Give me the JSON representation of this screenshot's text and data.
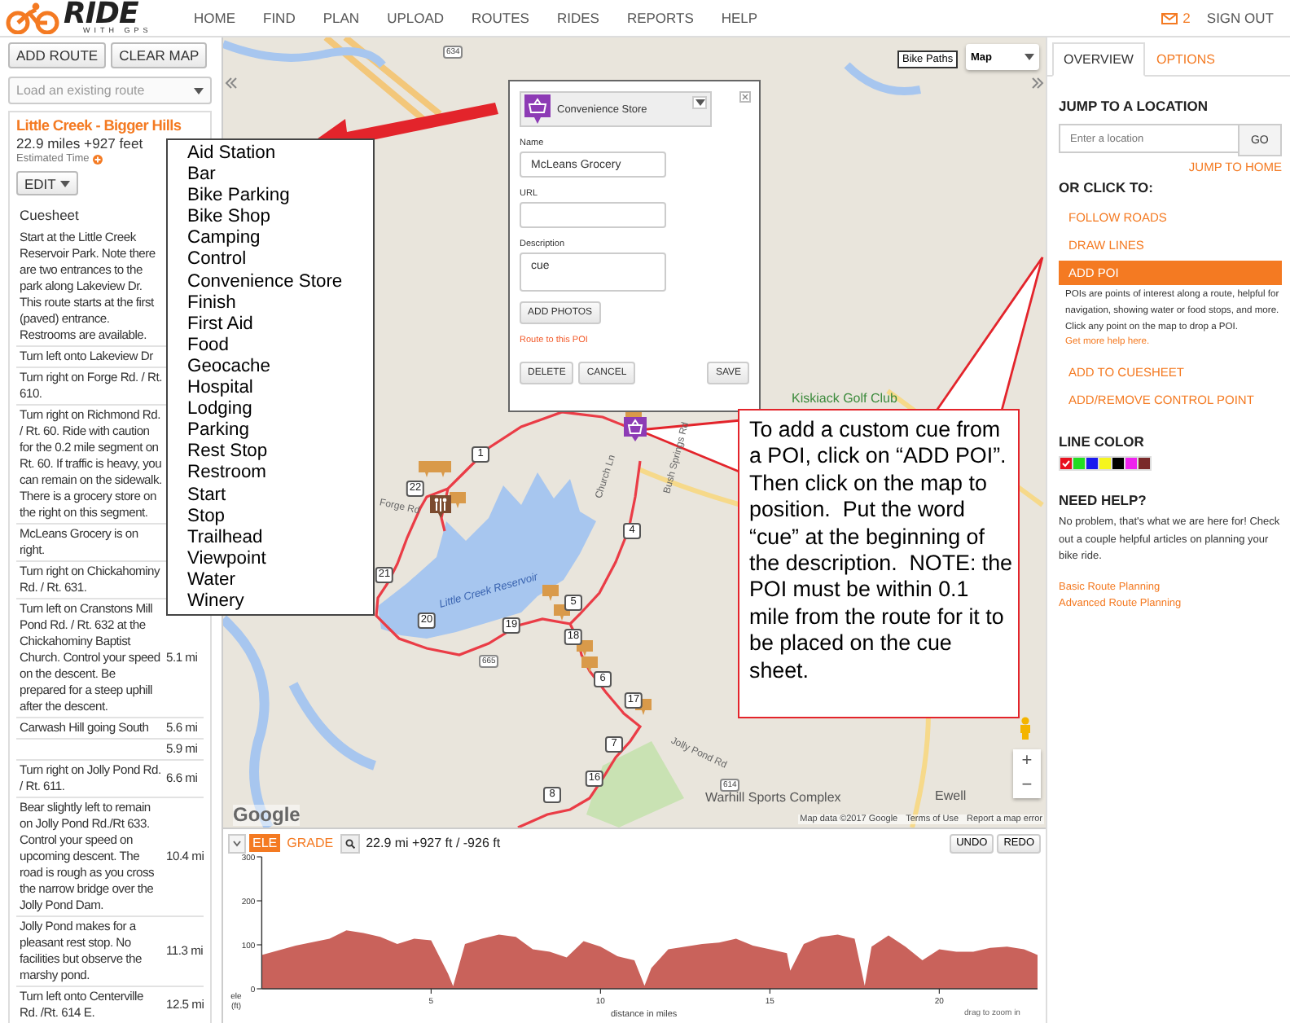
{
  "header": {
    "logo": {
      "wordmark": "RIDE",
      "tagline": "WITH GPS"
    },
    "nav": [
      {
        "label": "HOME"
      },
      {
        "label": "FIND"
      },
      {
        "label": "PLAN"
      },
      {
        "label": "UPLOAD"
      },
      {
        "label": "ROUTES"
      },
      {
        "label": "RIDES"
      },
      {
        "label": "REPORTS"
      },
      {
        "label": "HELP"
      }
    ],
    "message_count": "2",
    "sign_out": "SIGN OUT"
  },
  "left_panel": {
    "buttons": [
      "ADD ROUTE",
      "CLEAR MAP"
    ],
    "route_select": {
      "placeholder": "Load an existing route"
    },
    "route": {
      "title": "Little Creek - Bigger Hills",
      "stats": "22.9 miles +927 feet",
      "estimated_time": "Estimated Time",
      "edit_button": "EDIT"
    },
    "cuesheet": {
      "title": "Cuesheet",
      "rows": [
        {
          "text": "Start at the Little Creek Reservoir Park. Note there are two entrances to the park along Lakeview Dr. This route starts at the first (paved) entrance. Restrooms are available."
        },
        {
          "text": "Turn left onto Lakeview Dr"
        },
        {
          "text": "Turn right on Forge Rd. / Rt. 610."
        },
        {
          "text": "Turn right on Richmond Rd. / Rt. 60. Ride with caution for the 0.2 mile segment on Rt. 60. If traffic is heavy, you can remain on the sidewalk. There is a grocery store on the right on this segment."
        },
        {
          "text": "McLeans Grocery is on right."
        },
        {
          "text": "Turn right on Chickahominy Rd. / Rt. 631."
        },
        {
          "text": "Turn left on Cranstons Mill Pond Rd. / Rt. 632 at the Chickahominy Baptist Church. Control your speed on the descent. Be prepared for a steep uphill after the descent.",
          "distance": "5.1 mi"
        },
        {
          "text": "Carwash Hill going South",
          "distance": "5.6 mi"
        },
        {
          "distance": "5.9 mi"
        },
        {
          "text": "Turn right on Jolly Pond Rd. / Rt. 611.",
          "distance": "6.6 mi"
        },
        {
          "text": "Bear slightly left to remain on Jolly Pond Rd./Rt 633. Control your speed on upcoming descent. The road is rough as you cross the narrow bridge over the Jolly Pond Dam.",
          "distance": "10.4 mi"
        },
        {
          "text": "Jolly Pond makes for a pleasant rest stop. No facilities but observe the marshy pond.",
          "distance": "11.3 mi"
        },
        {
          "text": "Turn left onto Centerville Rd. /Rt. 614 E.",
          "distance": "12.5 mi"
        }
      ]
    }
  },
  "map": {
    "layer_button": "Bike Paths",
    "map_type": "Map",
    "labels": [
      {
        "kind": "water",
        "text": "Little Creek Reservoir"
      },
      {
        "kind": "park",
        "text": "Kiskiack Golf Club"
      },
      {
        "kind": "place",
        "text": "Warhill Sports Complex"
      },
      {
        "kind": "place",
        "text": "Ewell"
      },
      {
        "kind": "road",
        "text": "Forge Rd"
      },
      {
        "kind": "road",
        "text": "Church Ln"
      },
      {
        "kind": "road",
        "text": "Bush Springs Rd"
      },
      {
        "kind": "road",
        "text": "Jolly Pond Rd"
      },
      {
        "kind": "shield",
        "text": "634"
      },
      {
        "kind": "shield",
        "text": "665"
      },
      {
        "kind": "shield",
        "text": "614"
      }
    ],
    "waypoints": [
      "1",
      "22",
      "21",
      "20",
      "19",
      "5",
      "18",
      "6",
      "17",
      "7",
      "16",
      "8",
      "4"
    ],
    "poi_popup": {
      "type": "Convenience Store",
      "name_label": "Name",
      "name": "McLeans Grocery",
      "url_label": "URL",
      "description_label": "Description",
      "description": "cue",
      "add_photos": "ADD PHOTOS",
      "route_link": "Route to this POI",
      "buttons": [
        "DELETE",
        "CANCEL",
        "SAVE"
      ]
    },
    "poi_type_list": [
      "Aid Station",
      "Bar",
      "Bike Parking",
      "Bike Shop",
      "Camping",
      "Control",
      "Convenience Store",
      "Finish",
      "First Aid",
      "Food",
      "Geocache",
      "Hospital",
      "Lodging",
      "Parking",
      "Rest Stop",
      "Restroom",
      "Start",
      "Stop",
      "Trailhead",
      "Viewpoint",
      "Water",
      "Winery"
    ],
    "callout": "To add a custom cue from  a POI, click on “ADD POI”.  Then click on the map to position.  Put the word “cue” at the beginning of the description.  NOTE: the POI must be within 0.1 mile from the route for it to be placed on the cue sheet.",
    "zoom_controls": [
      "+",
      "−"
    ],
    "logo": "Google",
    "attribution": [
      "Map data ©2017 Google",
      "Terms of Use",
      "Report a map error"
    ]
  },
  "elevation": {
    "tabs": [
      {
        "label": "ELE",
        "selected": true
      },
      {
        "label": "GRADE",
        "selected": false
      }
    ],
    "summary": "22.9 mi +927 ft / -926 ft",
    "buttons": [
      "UNDO",
      "REDO"
    ],
    "hint": "drag to zoom in",
    "chart_data": {
      "type": "area",
      "xlabel": "distance in miles",
      "ylabel": "ele (ft)",
      "xlim": [
        0,
        22.9
      ],
      "ylim": [
        0,
        300
      ],
      "xticks": [
        5,
        10,
        15,
        20
      ],
      "yticks": [
        0,
        100,
        200,
        300
      ],
      "x": [
        0,
        1,
        2,
        2.5,
        3,
        3.5,
        4,
        4.5,
        5,
        5.5,
        5.65,
        6,
        6.5,
        7,
        7.5,
        8,
        8.5,
        9,
        9.5,
        10,
        10.5,
        11,
        11.3,
        11.5,
        12,
        12.5,
        13,
        13.5,
        14,
        14.5,
        15,
        15.5,
        15.6,
        16,
        16.5,
        17,
        17.5,
        17.8,
        18,
        18.5,
        19,
        19.5,
        20,
        20.5,
        21,
        21.5,
        22,
        22.5,
        22.9
      ],
      "series": [
        {
          "color": "#c9625b",
          "values": [
            77,
            98,
            114,
            133,
            127,
            118,
            102,
            114,
            110,
            34,
            6,
            102,
            114,
            123,
            118,
            90,
            84,
            71,
            108,
            96,
            74,
            65,
            7,
            47,
            90,
            96,
            102,
            105,
            114,
            98,
            90,
            81,
            41,
            102,
            118,
            123,
            114,
            7,
            96,
            121,
            96,
            65,
            90,
            84,
            84,
            93,
            96,
            90,
            77
          ]
        }
      ]
    }
  },
  "right_panel": {
    "tabs": [
      {
        "label": "OVERVIEW",
        "selected": true
      },
      {
        "label": "OPTIONS",
        "selected": false
      }
    ],
    "jump_heading": "JUMP TO A LOCATION",
    "location_field": {
      "placeholder": "Enter a location"
    },
    "go_button": "GO",
    "jump_home": "JUMP TO HOME",
    "click_heading": "OR CLICK TO:",
    "options": [
      {
        "label": "FOLLOW ROADS",
        "selected": false
      },
      {
        "label": "DRAW LINES",
        "selected": false
      },
      {
        "label": "ADD POI",
        "selected": true
      },
      {
        "label": "ADD TO CUESHEET",
        "selected": false
      },
      {
        "label": "ADD/REMOVE CONTROL POINT",
        "selected": false
      }
    ],
    "poi_help": {
      "text": "POIs are points of interest along a route, helpful for navigation, showing water or food stops, and more. Click any point on the map to drop a POI.",
      "link": "Get more help here."
    },
    "line_color_heading": "LINE COLOR",
    "line_colors": [
      {
        "color": "#e8101e",
        "selected": true
      },
      {
        "color": "#22dd22",
        "selected": false
      },
      {
        "color": "#1a1aee",
        "selected": false
      },
      {
        "color": "#f5f51e",
        "selected": false
      },
      {
        "color": "#000000",
        "selected": false
      },
      {
        "color": "#ee22ee",
        "selected": false
      },
      {
        "color": "#7a2a2a",
        "selected": false
      }
    ],
    "help_heading": "NEED HELP?",
    "help_text": "No problem, that's what we are here for! Check out a couple helpful articles on planning your bike ride.",
    "help_links": [
      "Basic Route Planning",
      "Advanced Route Planning"
    ]
  }
}
